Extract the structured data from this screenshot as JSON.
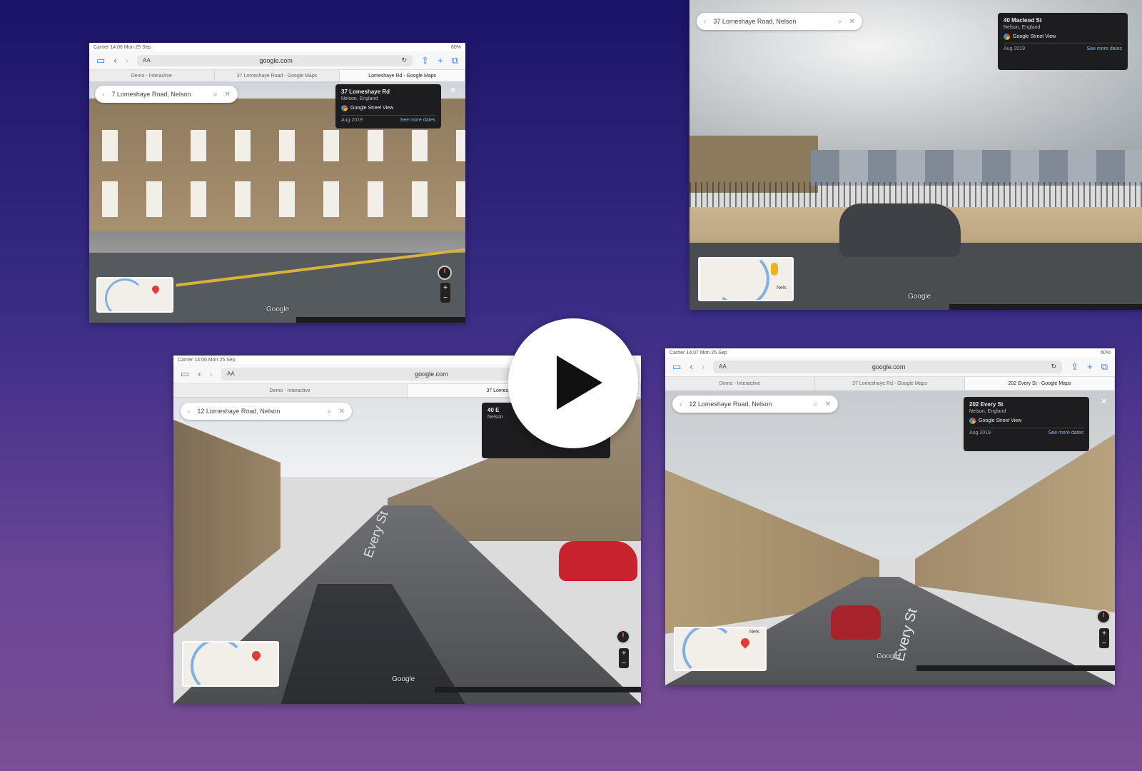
{
  "shots": [
    {
      "id": "top-left",
      "status_left": "Carrier 14:06 Mon 25 Sep",
      "status_right": "60%",
      "url_aa": "AA",
      "url": "google.com",
      "tabs": [
        "Demo - Interactive",
        "37 Lomeshaye Road - Google Maps",
        "Lomeshaye Rd - Google Maps"
      ],
      "search": "7 Lomeshaye Road, Nelson",
      "card": {
        "title": "37 Lomeshaye Rd",
        "sub": "Nelson, England",
        "source": "Google Street View",
        "date": "Aug 2019",
        "link": "See more dates"
      },
      "google_label": "Google"
    },
    {
      "id": "top-right",
      "search": "37 Lomeshaye Road, Nelson",
      "card": {
        "title": "40 Macleod St",
        "sub": "Nelson, England",
        "source": "Google Street View",
        "date": "Aug 2019",
        "link": "See more dates"
      },
      "google_label": "Google",
      "minimap_label": "Nels"
    },
    {
      "id": "bottom-left",
      "status_left": "Carrier 14:06 Mon 25 Sep",
      "url_aa": "AA",
      "url": "google.com",
      "tabs": [
        "Demo - Interactive",
        "37 Lomeshaye Rd - Google Maps"
      ],
      "search": "12 Lomeshaye Road, Nelson",
      "card": {
        "title": "40 E",
        "sub": "Nelson"
      },
      "google_label": "Google",
      "road_label": "Every St"
    },
    {
      "id": "bottom-right",
      "status_left": "Carrier 14:07 Mon 25 Sep",
      "status_right": "60%",
      "url_aa": "AA",
      "url": "google.com",
      "tabs": [
        "Demo - Interactive",
        "37 Lomeshaye Rd - Google Maps",
        "202 Every St - Google Maps"
      ],
      "search": "12 Lomeshaye Road, Nelson",
      "card": {
        "title": "202 Every St",
        "sub": "Nelson, England",
        "source": "Google Street View",
        "date": "Aug 2019",
        "link": "See more dates"
      },
      "google_label": "Google",
      "road_label": "Every St",
      "minimap_label": "Nels"
    }
  ],
  "icons": {
    "back": "‹",
    "forward": "›",
    "share": "⇪",
    "add": "+",
    "tabs": "⧉",
    "sidebar": "▭",
    "search": "⌕",
    "close": "✕",
    "reload": "↻",
    "play": "play-icon"
  }
}
